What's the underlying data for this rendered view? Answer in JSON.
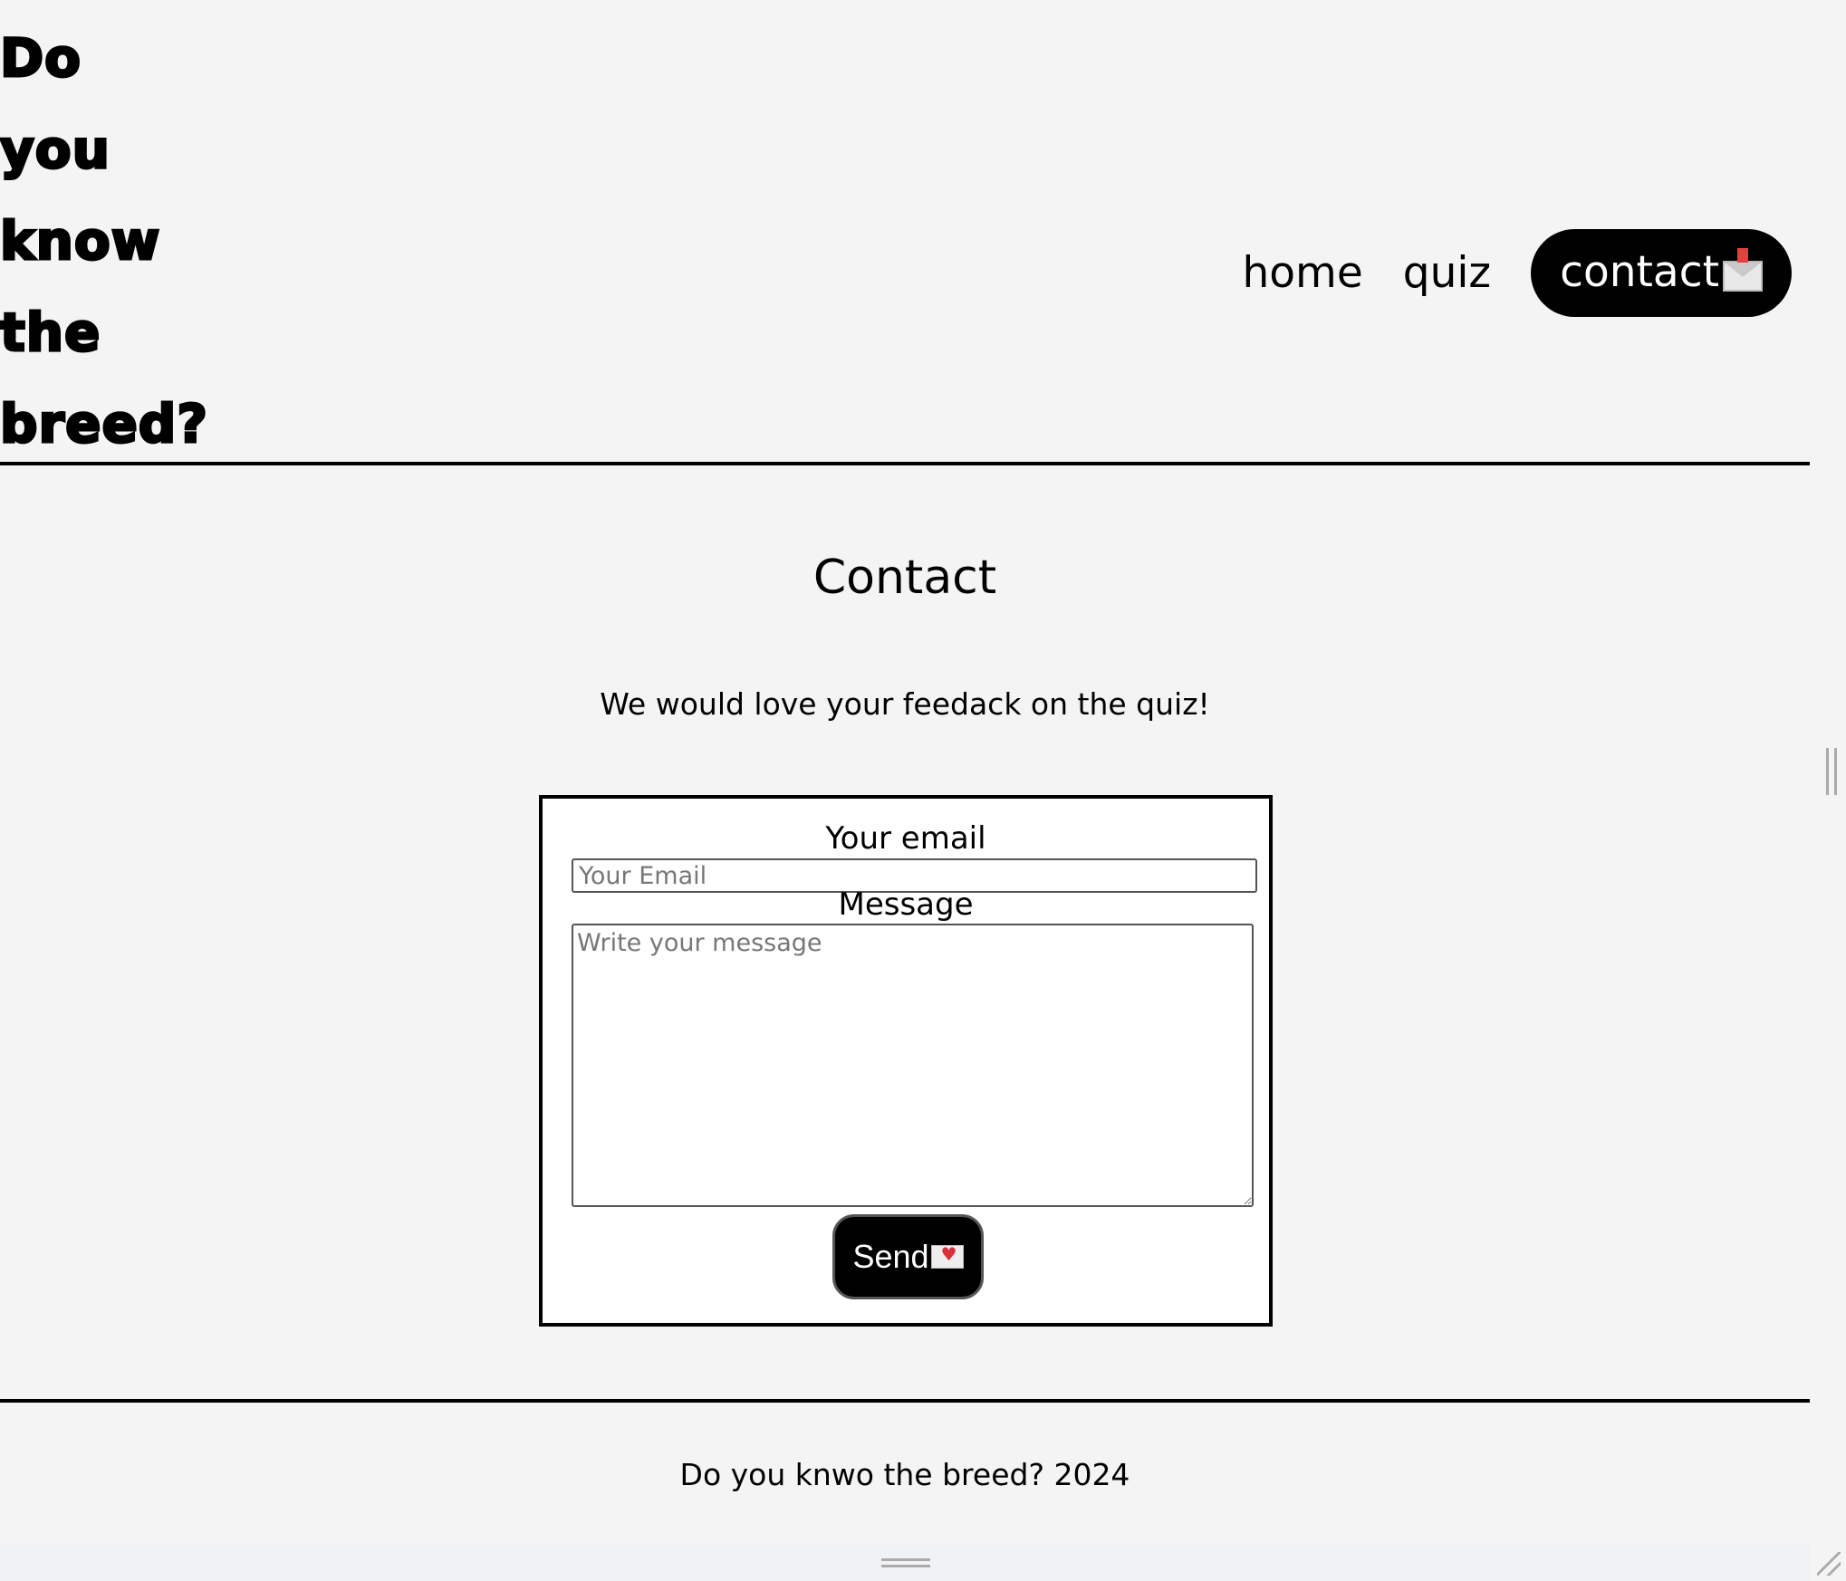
{
  "site": {
    "logo_lines": [
      "Do",
      "you",
      "know",
      "the",
      "breed?"
    ]
  },
  "nav": {
    "items": [
      {
        "label": "home"
      },
      {
        "label": "quiz"
      },
      {
        "label": "contact"
      }
    ],
    "active": "contact",
    "contact_icon": "envelope-with-arrow-icon"
  },
  "main": {
    "title": "Contact",
    "intro": "We would love your feedack on the quiz!",
    "form": {
      "email_label": "Your email",
      "email_placeholder": "Your Email",
      "email_value": "",
      "message_label": "Message",
      "message_placeholder": "Write your message",
      "message_value": "",
      "send_label": "Send",
      "send_icon": "love-letter-icon"
    }
  },
  "footer": {
    "text": "Do you knwo the breed? 2024"
  },
  "colors": {
    "background": "#f4f4f4",
    "accent": "#000000",
    "form_background": "#ffffff"
  }
}
